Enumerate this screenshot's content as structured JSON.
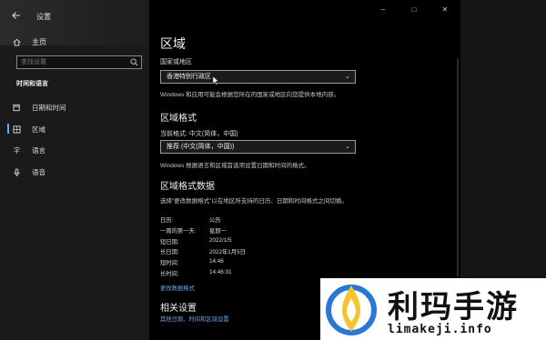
{
  "window": {
    "app_title": "设置",
    "back_icon": "back-arrow-icon",
    "caption_buttons": [
      "–",
      "□",
      "✕"
    ]
  },
  "sidebar": {
    "home_label": "主页",
    "search_placeholder": "查找设置",
    "section_label": "时间和语言",
    "items": [
      {
        "label": "日期和时间",
        "icon": "calendar-clock-icon"
      },
      {
        "label": "区域",
        "icon": "globe-icon",
        "active": true
      },
      {
        "label": "语言",
        "icon": "language-icon"
      },
      {
        "label": "语音",
        "icon": "microphone-icon"
      }
    ]
  },
  "main": {
    "title": "区域",
    "country_label": "国家或地区",
    "country_value": "香港特别行政区",
    "country_desc": "Windows 和应用可能会根据您所在的国家或地区向您提供本地内容。",
    "format_heading": "区域格式",
    "current_format_label": "当前格式: 中文(简体，中国)",
    "format_value": "推荐 (中文(简体，中国))",
    "format_desc": "Windows 根据语言和区域首选项设置日期和时间的格式。",
    "data_heading": "区域格式数据",
    "data_desc": "选择“更改数据格式”以在地区所支持的日历、日期和时间格式之间切换。",
    "data_rows": [
      {
        "key": "日历:",
        "value": "公历"
      },
      {
        "key": "一周的第一天:",
        "value": "星期一"
      },
      {
        "key": "短日期:",
        "value": "2022/1/5"
      },
      {
        "key": "长日期:",
        "value": "2022年1月5日"
      },
      {
        "key": "短时间:",
        "value": "14:46"
      },
      {
        "key": "长时间:",
        "value": "14:46:31"
      }
    ],
    "change_link": "更改数据格式",
    "related_heading": "相关设置",
    "related_link": "其他日期、时间和区域设置"
  },
  "watermark": {
    "brand": "利玛手游",
    "domain": "limakeji.info"
  },
  "colors": {
    "accent": "#6ea7e6",
    "background": "#000000",
    "sidebar": "#1a1a1a"
  }
}
